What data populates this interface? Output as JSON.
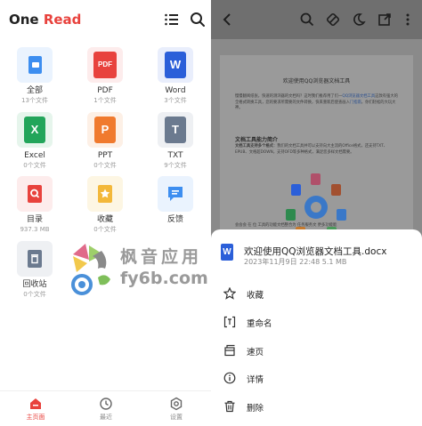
{
  "left": {
    "title_main": "One ",
    "title_accent": "Read",
    "tiles": [
      {
        "name": "全部",
        "sub": "13个文件",
        "icon": "folder-icon",
        "color": "#3d8ef0"
      },
      {
        "name": "PDF",
        "sub": "1个文件",
        "icon": "pdf-icon",
        "glyph": "PDF",
        "color": "#e8423d"
      },
      {
        "name": "Word",
        "sub": "3个文件",
        "icon": "word-icon",
        "glyph": "W",
        "color": "#2b5fd9"
      },
      {
        "name": "Excel",
        "sub": "0个文件",
        "icon": "excel-icon",
        "glyph": "X",
        "color": "#22a55a"
      },
      {
        "name": "PPT",
        "sub": "0个文件",
        "icon": "ppt-icon",
        "glyph": "P",
        "color": "#f07a2e"
      },
      {
        "name": "TXT",
        "sub": "9个文件",
        "icon": "txt-icon",
        "glyph": "T",
        "color": "#6b7a8f"
      },
      {
        "name": "目录",
        "sub": "937.3 MB",
        "icon": "directory-icon",
        "color": "#e8423d"
      },
      {
        "name": "收藏",
        "sub": "0个文件",
        "icon": "favorites-icon",
        "color": "#f3b83a"
      },
      {
        "name": "反馈",
        "sub": "",
        "icon": "feedback-icon",
        "color": "#3d8ef0"
      },
      {
        "name": "回收站",
        "sub": "0个文件",
        "icon": "trash-icon",
        "color": "#6b7a8f"
      }
    ],
    "nav": [
      {
        "label": "主页面",
        "icon": "home-icon"
      },
      {
        "label": "最近",
        "icon": "clock-icon"
      },
      {
        "label": "设置",
        "icon": "settings-icon"
      }
    ],
    "watermark_line1": "枫音应用",
    "watermark_line2": "fy6b.com"
  },
  "right": {
    "document": {
      "title": "欢迎使用QQ浏览器文档工具",
      "p1_a": "慢慢翻阅纸张，快速的测浏器的文档吗？这时我们推荐用了们一",
      "p1_link": "QQ浏览器文档工具",
      "p1_b": "这款有强大的全格式转换工具，您的要求所需要的文件转换，快来重新后使查画入",
      "p1_c": "门指南",
      "p1_d": "，你们轻松的大玩大神。",
      "h2": "文档工具能力简介",
      "p2_a": "文档工具支持多个格式",
      "p2_b": "：我们的文档工具并可以支持向大主流的Office格式，还支持TXT、EPUB、文格超DOWN，支持OFD等多种格式，满足您多样文档需要。",
      "bottom": "会会会 在 位 工具的功能文档整合为 任务服务文 更多功能能"
    },
    "sheet": {
      "filename": "欢迎使用QQ浏览器文档工具.docx",
      "meta": "2023年11月9日 22:48 5.1 MB",
      "file_glyph": "W",
      "actions": [
        {
          "label": "收藏",
          "icon": "star-icon"
        },
        {
          "label": "重命名",
          "icon": "rename-icon"
        },
        {
          "label": "速页",
          "icon": "page-icon"
        },
        {
          "label": "详情",
          "icon": "info-icon"
        },
        {
          "label": "删除",
          "icon": "delete-icon"
        }
      ]
    }
  },
  "colors": {
    "accent": "#e8423d",
    "word_blue": "#2b5fd9",
    "overlay": "#8a8a8a"
  }
}
